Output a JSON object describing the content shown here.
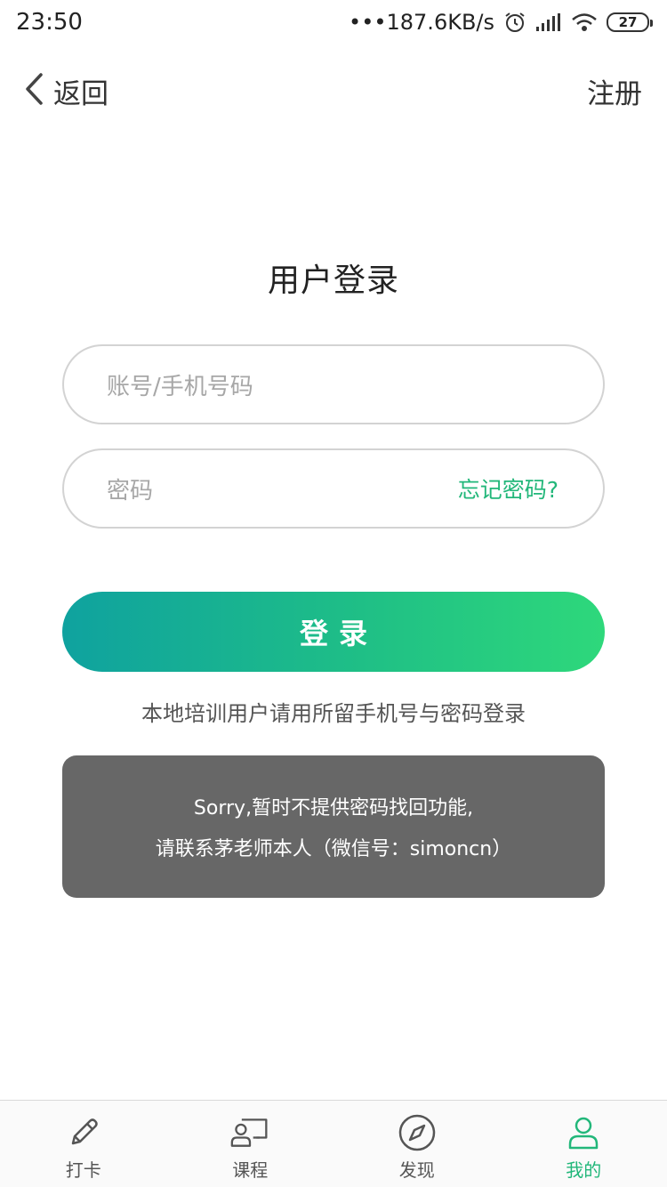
{
  "status_bar": {
    "time": "23:50",
    "speed": "•••187.6KB/s",
    "battery": "27"
  },
  "nav": {
    "back_label": "返回",
    "register_label": "注册"
  },
  "login": {
    "title": "用户登录",
    "account_placeholder": "账号/手机号码",
    "password_placeholder": "密码",
    "forgot_label": "忘记密码?",
    "submit_label": "登录",
    "hint": "本地培训用户请用所留手机号与密码登录"
  },
  "toast": {
    "line1": "Sorry,暂时不提供密码找回功能,",
    "line2": "请联系茅老师本人（微信号：simoncn）"
  },
  "tabs": [
    {
      "label": "打卡",
      "icon": "pencil-icon"
    },
    {
      "label": "课程",
      "icon": "course-icon"
    },
    {
      "label": "发现",
      "icon": "compass-icon"
    },
    {
      "label": "我的",
      "icon": "user-icon",
      "active": true
    }
  ],
  "colors": {
    "accent": "#22b77a",
    "button_start": "#0fa29f",
    "button_end": "#2ed87b",
    "toast_bg": "#676767"
  }
}
